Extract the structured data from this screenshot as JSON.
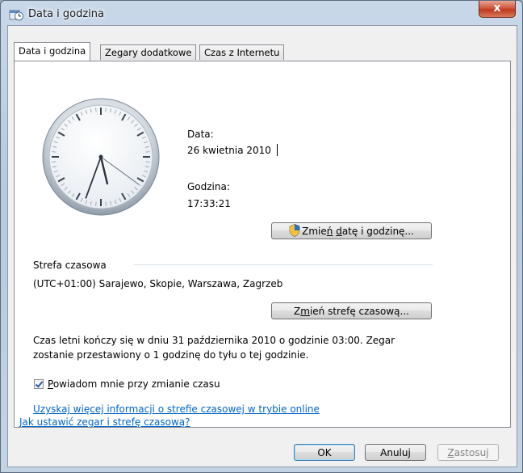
{
  "window": {
    "title": "Data i godzina",
    "close_glyph": "x"
  },
  "tabs": [
    {
      "label": "Data i godzina",
      "active": true
    },
    {
      "label": "Zegary dodatkowe",
      "active": false
    },
    {
      "label": "Czas z Internetu",
      "active": false
    }
  ],
  "clock": {
    "hours": 17,
    "minutes": 33,
    "seconds": 21
  },
  "date": {
    "label": "Data:",
    "value": "26 kwietnia 2010"
  },
  "time": {
    "label": "Godzina:",
    "value": "17:33:21"
  },
  "change_datetime_button": {
    "pre": "Zmie",
    "accel": "ń",
    "mid": " ",
    "accel2": "d",
    "post": "atę i godzinę..."
  },
  "timezone": {
    "section_label": "Strefa czasowa",
    "value": "(UTC+01:00) Sarajewo, Skopie, Warszawa, Zagrzeb",
    "button_pre": "Z",
    "button_accel": "m",
    "button_post": "ień strefę czasową..."
  },
  "dst_note": {
    "line1": "Czas letni kończy się w dniu 31 października 2010 o godzinie 03:00. Zegar",
    "line2": "zostanie przestawiony o 1 godzinę do tyłu o tej godzinie."
  },
  "notify_checkbox": {
    "accel": "P",
    "label_rest": "owiadom mnie przy zmianie czasu",
    "checked": true
  },
  "links": {
    "more_info": "Uzyskaj więcej informacji o strefie czasowej w trybie online",
    "how_to": "Jak ustawić zegar i strefę czasową?"
  },
  "footer": {
    "ok": "OK",
    "cancel": "Anuluj",
    "apply_accel": "Z",
    "apply_rest": "astosuj"
  },
  "colors": {
    "link": "#0066cc",
    "close_button": "#c0391d",
    "panel_bg": "#ffffff"
  }
}
